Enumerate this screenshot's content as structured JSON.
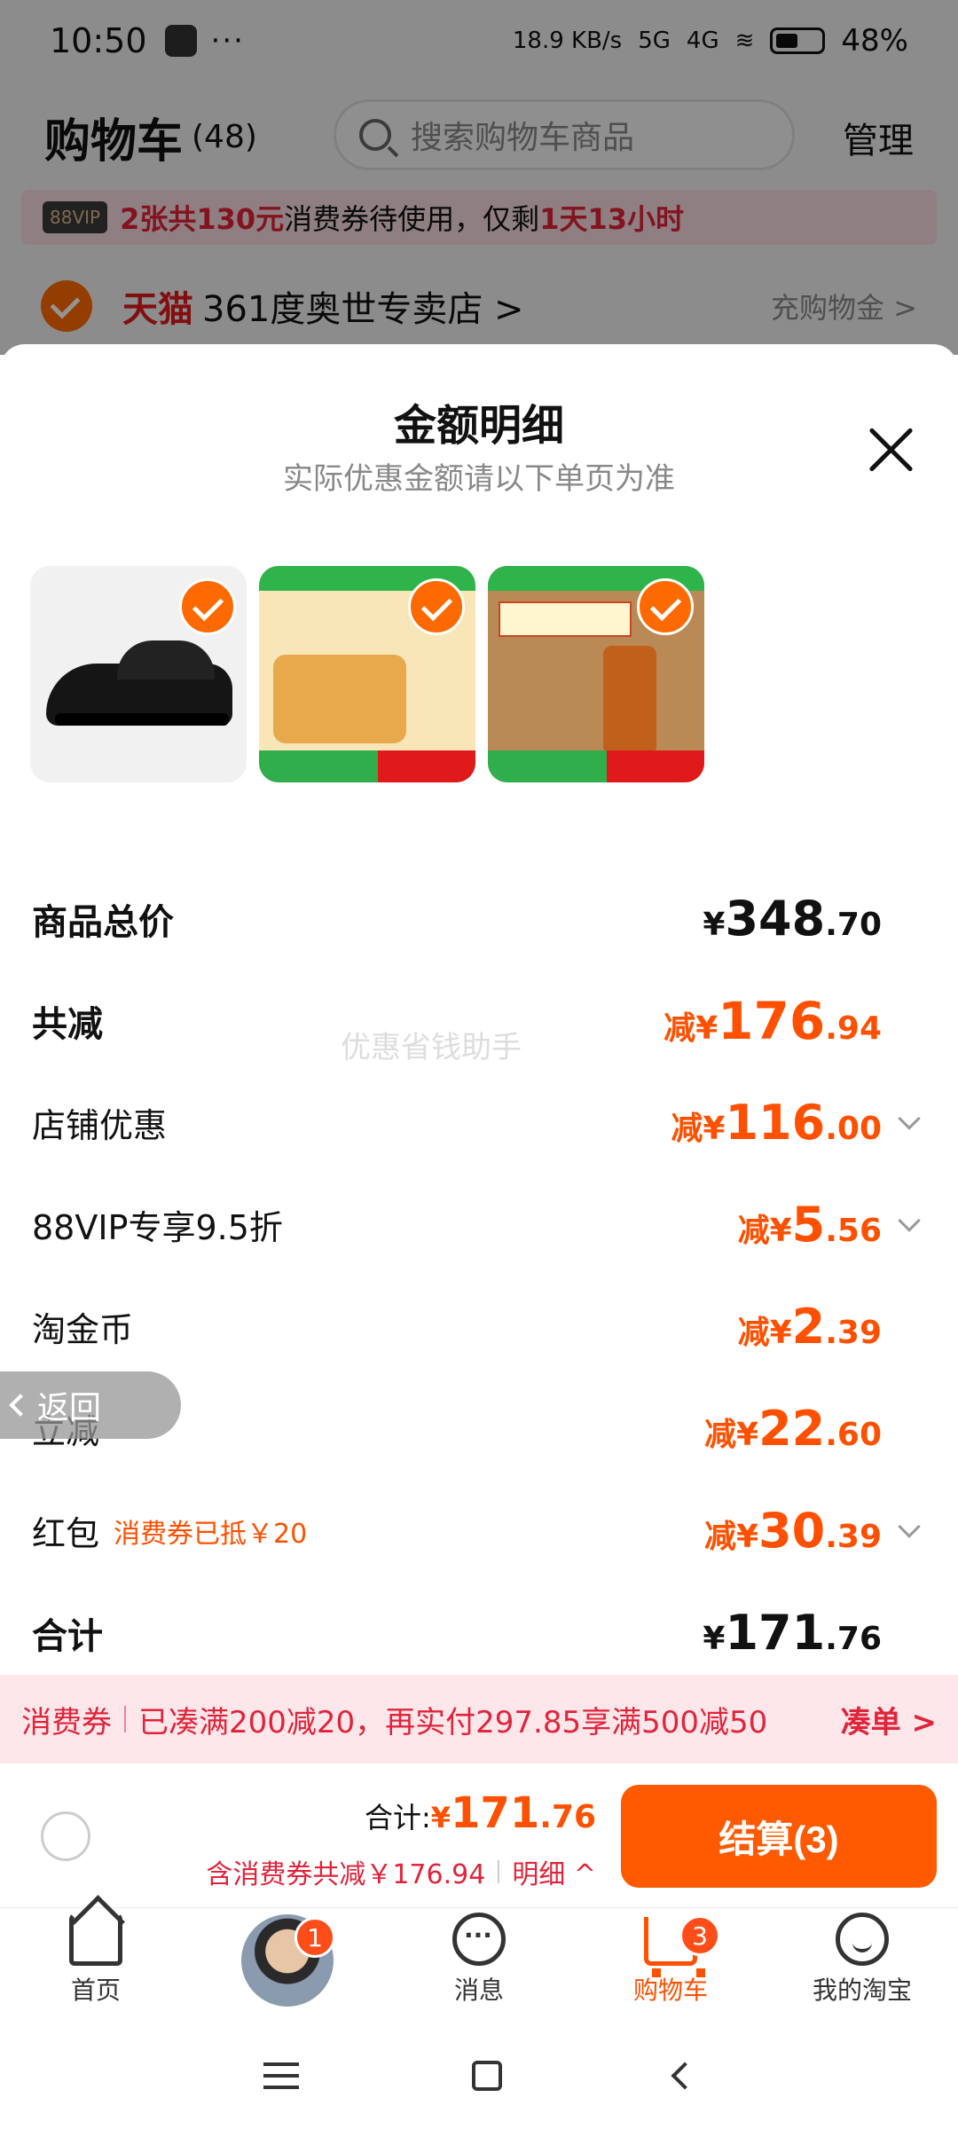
{
  "statusbar": {
    "time": "10:50",
    "net_speed": "18.9 KB/s",
    "signal1": "5G",
    "signal2": "4G",
    "battery": "48%"
  },
  "cart_header": {
    "title": "购物车",
    "count": "(48)",
    "search_placeholder": "搜索购物车商品",
    "manage": "管理"
  },
  "promo": {
    "vip": "88VIP",
    "highlight": "2张共130元",
    "text": "消费券待使用，仅剩",
    "time_left": "1天13小时"
  },
  "store": {
    "platform": "天猫",
    "name": "361度奥世专卖店 >",
    "gold": "充购物金 >"
  },
  "sheet": {
    "title": "金额明细",
    "subtitle": "实际优惠金额请以下单页为准",
    "watermark": "优惠省钱助手",
    "thumb_alts": [
      "361度黑色跑鞋",
      "天猫超市 牛奶千层面包",
      "100%纯芝麻油"
    ],
    "rows": [
      {
        "label": "商品总价",
        "prefix": "¥",
        "int": "348",
        "dec": ".70"
      },
      {
        "label": "共减",
        "prefix": "减¥",
        "int": "176",
        "dec": ".94"
      },
      {
        "label": "店铺优惠",
        "prefix": "减¥",
        "int": "116",
        "dec": ".00"
      },
      {
        "label": "88VIP专享9.5折",
        "prefix": "减¥",
        "int": "5",
        "dec": ".56"
      },
      {
        "label": "淘金币",
        "prefix": "减¥",
        "int": "2",
        "dec": ".39"
      },
      {
        "label": "立减",
        "prefix": "减¥",
        "int": "22",
        "dec": ".60"
      },
      {
        "label": "红包",
        "note": "消费券已抵￥20",
        "prefix": "减¥",
        "int": "30",
        "dec": ".39"
      },
      {
        "label": "合计",
        "prefix": "¥",
        "int": "171",
        "dec": ".76"
      }
    ]
  },
  "back_pill": "返回",
  "coupon_strip": {
    "tag": "消费券",
    "text": "已凑满200减20，再实付297.85享满500减50",
    "action": "凑单 >"
  },
  "checkout": {
    "total_label": "合计:",
    "total_prefix": "¥",
    "total_int": "171",
    "total_dec": ".76",
    "saving": "含消费券共减￥176.94",
    "detail": "明细 ^",
    "settle": "结算(3)"
  },
  "tabbar": {
    "tabs": [
      {
        "label": "首页",
        "icon": "home-icon"
      },
      {
        "label": "",
        "icon": "avatar",
        "badge": "1"
      },
      {
        "label": "消息",
        "icon": "message-icon"
      },
      {
        "label": "购物车",
        "icon": "cart-icon",
        "badge": "3",
        "active": true
      },
      {
        "label": "我的淘宝",
        "icon": "profile-icon"
      }
    ]
  },
  "colors": {
    "accent": "#ff5000",
    "settle_button": "#ff5a00",
    "coupon_red": "#e0243b",
    "tmall_red": "#e01a1a"
  }
}
